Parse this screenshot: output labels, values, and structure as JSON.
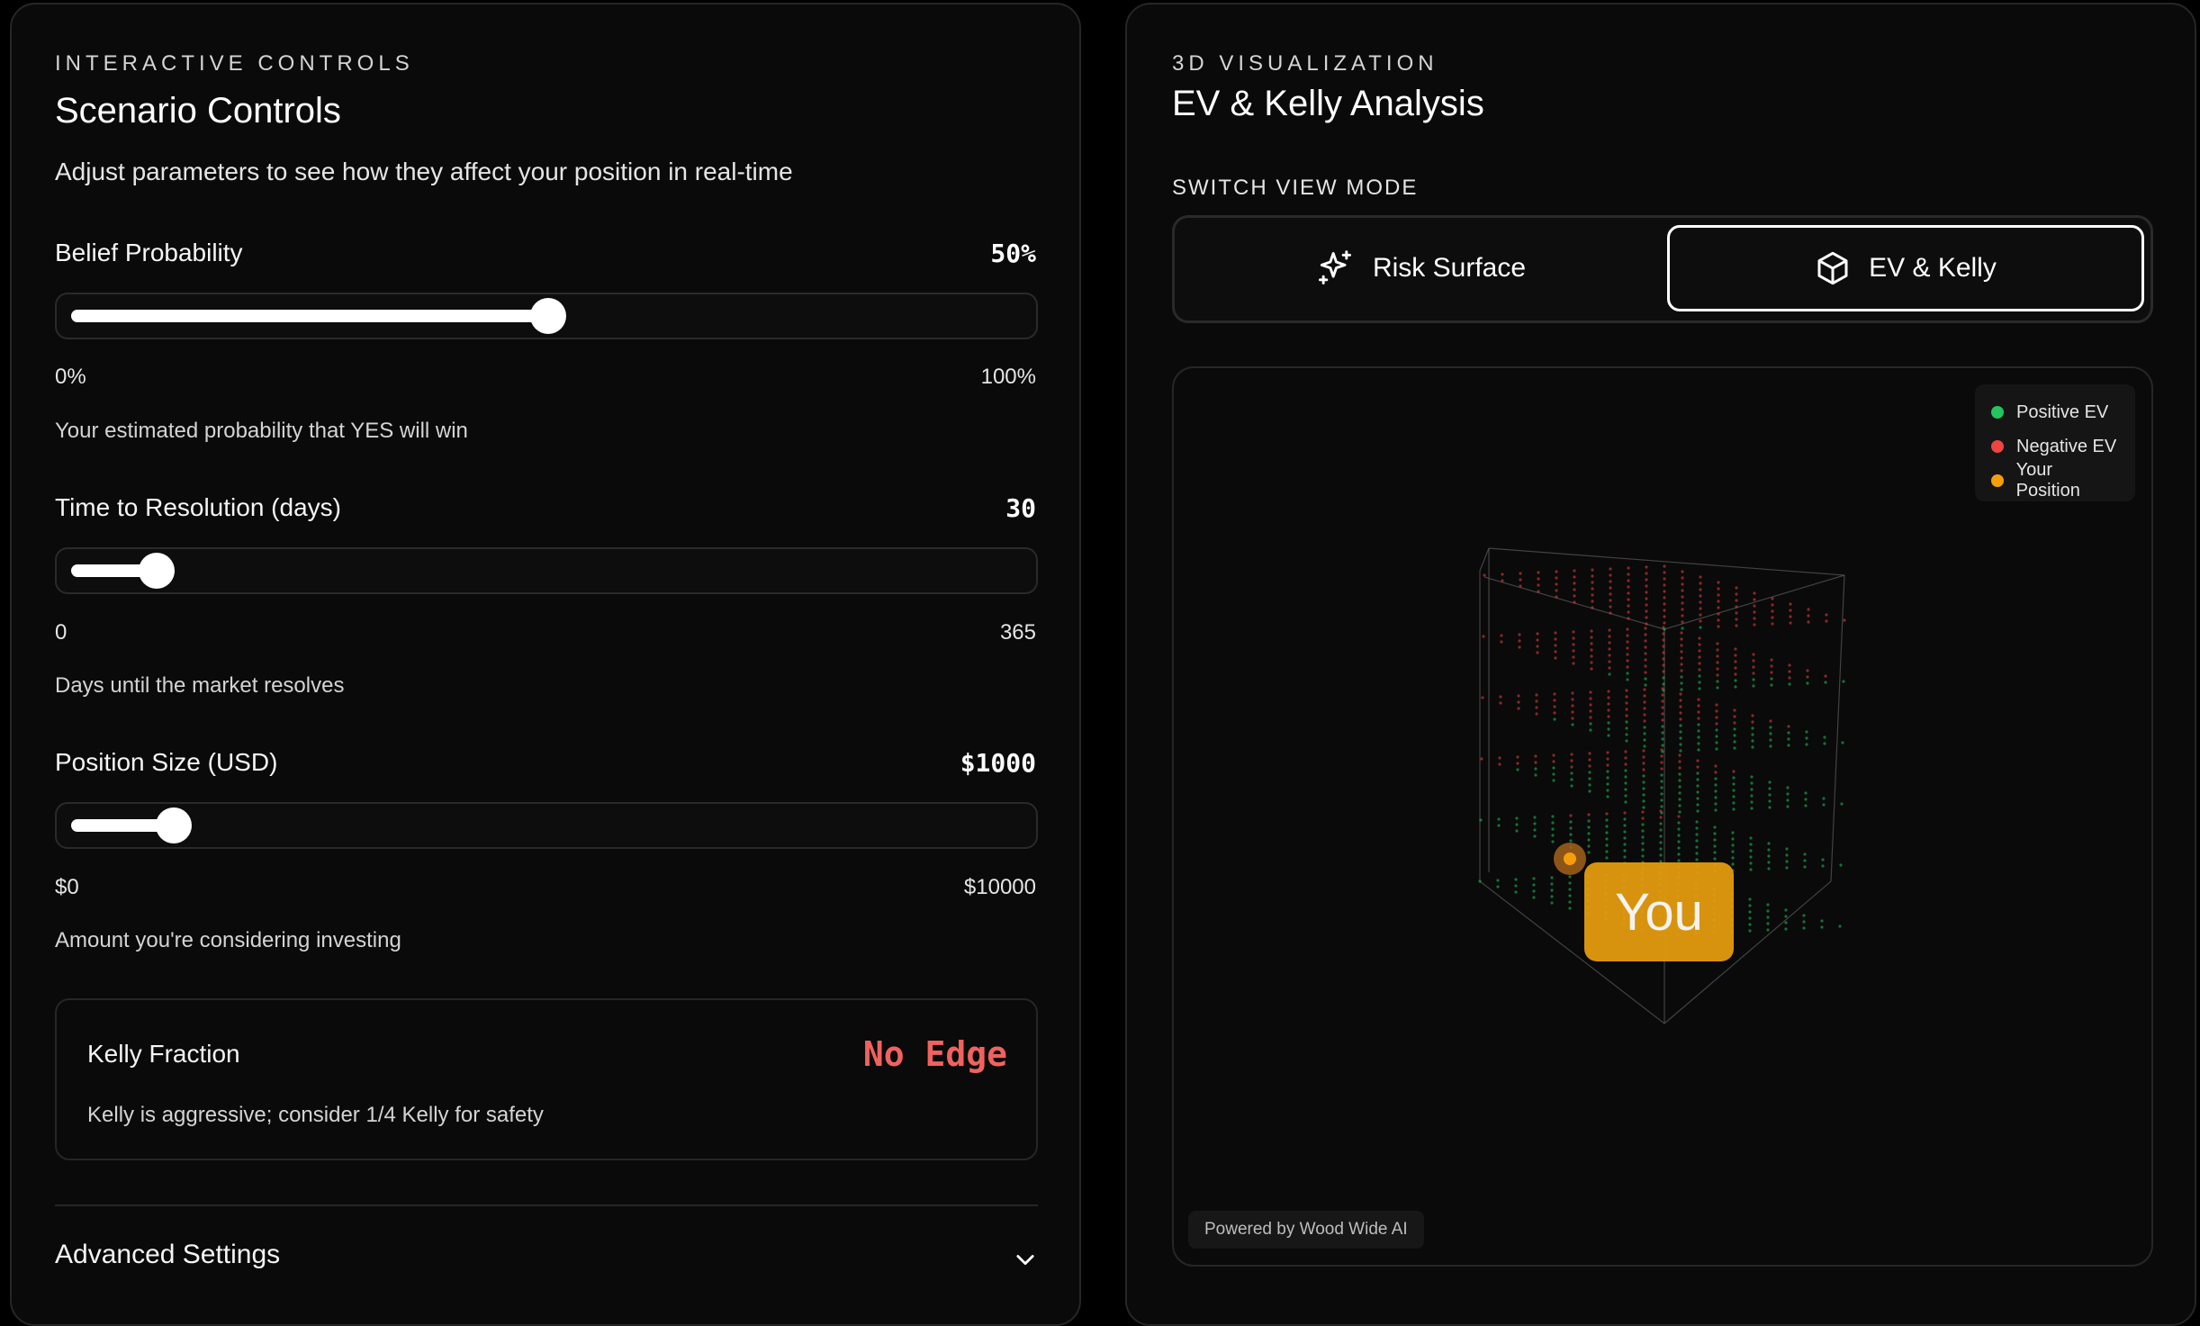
{
  "left": {
    "eyebrow": "INTERACTIVE CONTROLS",
    "title": "Scenario Controls",
    "subtitle": "Adjust parameters to see how they affect your position in real-time",
    "controls": [
      {
        "label": "Belief Probability",
        "value": "50%",
        "min": "0%",
        "max": "100%",
        "help": "Your estimated probability that YES will win",
        "fraction": 0.5
      },
      {
        "label": "Time to Resolution (days)",
        "value": "30",
        "min": "0",
        "max": "365",
        "help": "Days until the market resolves",
        "fraction": 0.082
      },
      {
        "label": "Position Size (USD)",
        "value": "$1000",
        "min": "$0",
        "max": "$10000",
        "help": "Amount you're considering investing",
        "fraction": 0.1
      }
    ],
    "kelly": {
      "label": "Kelly Fraction",
      "value": "No Edge",
      "note": "Kelly is aggressive; consider 1/4 Kelly for safety",
      "value_color": "#f0625f"
    },
    "advanced": "Advanced Settings"
  },
  "right": {
    "eyebrow": "3D VISUALIZATION",
    "title": "EV & Kelly Analysis",
    "mode_label": "SWITCH VIEW MODE",
    "modes": [
      {
        "label": "Risk Surface",
        "icon": "sparkles-icon",
        "active": false
      },
      {
        "label": "EV & Kelly",
        "icon": "cube-icon",
        "active": true
      }
    ],
    "legend": [
      {
        "label": "Positive EV",
        "color": "#22c55e"
      },
      {
        "label": "Negative EV",
        "color": "#ef4444"
      },
      {
        "label": "Your Position",
        "color": "#f59e0b"
      }
    ],
    "you_label": "You",
    "powered": "Powered by Wood Wide AI"
  }
}
